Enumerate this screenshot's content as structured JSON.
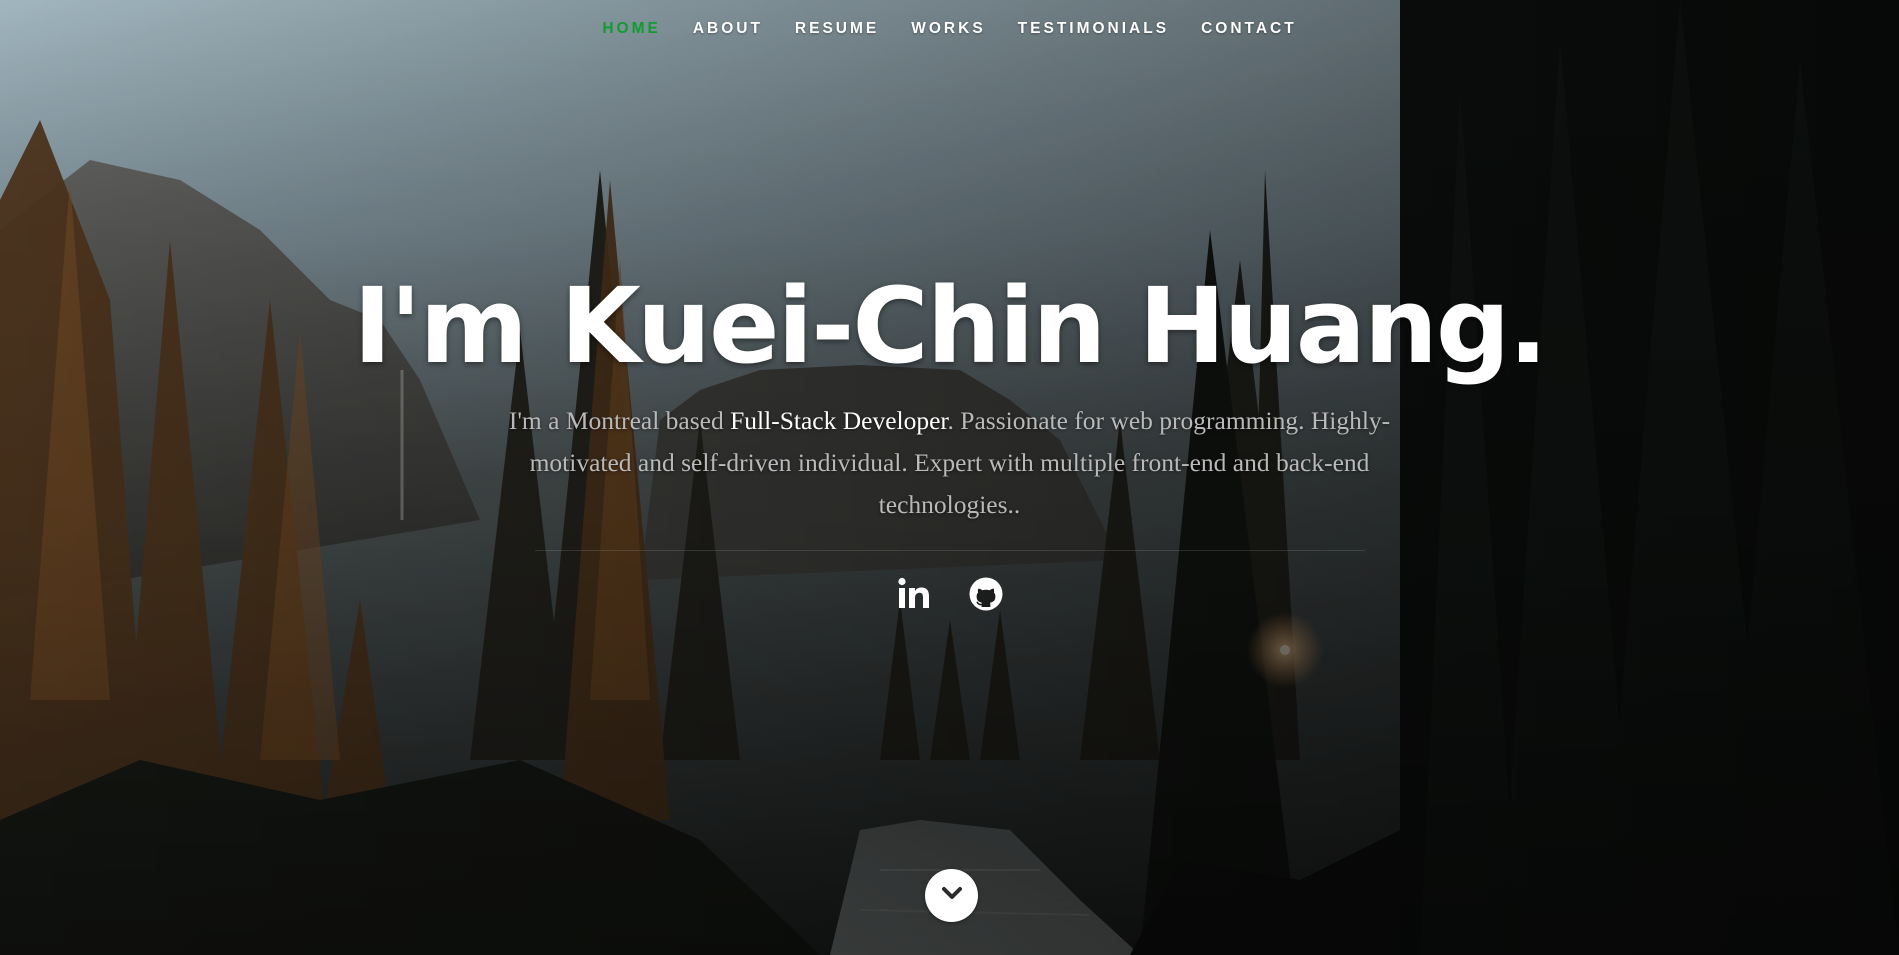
{
  "nav": {
    "items": [
      {
        "label": "HOME",
        "active": true
      },
      {
        "label": "ABOUT",
        "active": false
      },
      {
        "label": "RESUME",
        "active": false
      },
      {
        "label": "WORKS",
        "active": false
      },
      {
        "label": "TESTIMONIALS",
        "active": false
      },
      {
        "label": "CONTACT",
        "active": false
      }
    ],
    "active_color": "#0f9d2f"
  },
  "banner": {
    "headline": "I'm Kuei-Chin Huang.",
    "intro_prefix": "I'm a Montreal based ",
    "intro_role": "Full-Stack Developer",
    "intro_rest": ". Passionate for web programming. Highly-motivated and self-driven individual. Expert with multiple front-end and back-end technologies.."
  },
  "social": [
    {
      "icon": "linkedin-icon"
    },
    {
      "icon": "github-icon"
    }
  ],
  "scroll_button": {
    "icon": "chevron-down-icon"
  },
  "background": {
    "icon": "forest-river-photo",
    "sky_top": "#a9c3cf",
    "forest": "#151a17"
  }
}
